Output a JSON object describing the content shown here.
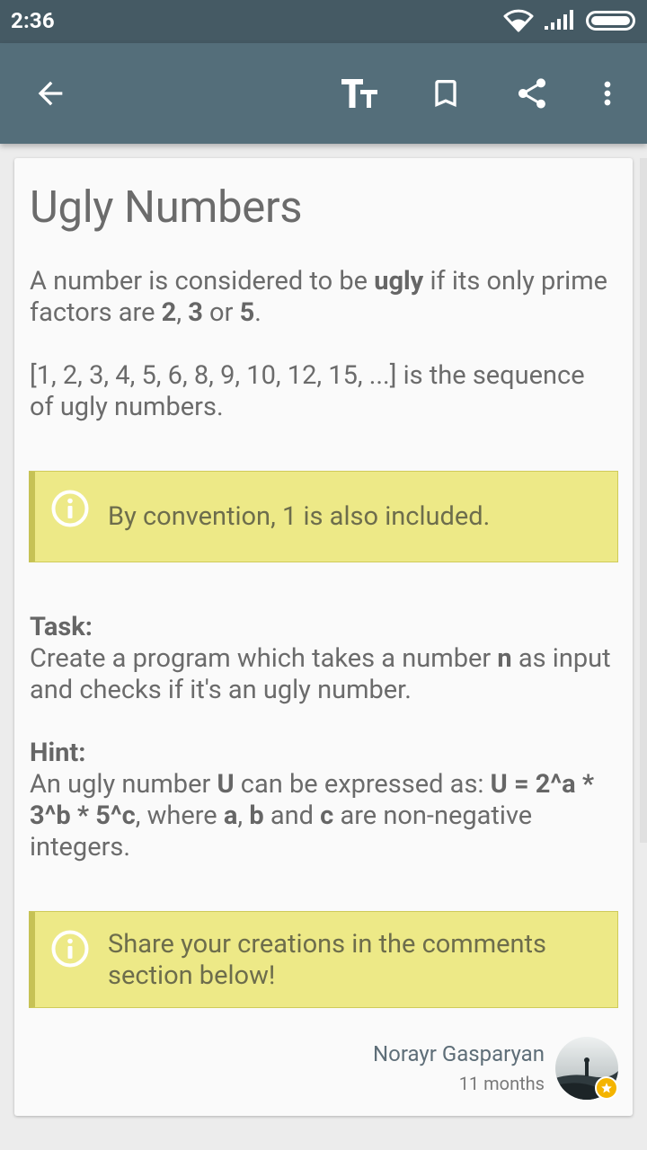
{
  "status_bar": {
    "time": "2:36"
  },
  "toolbar": {
    "icons": [
      "back-arrow-icon",
      "text-size-icon",
      "bookmark-icon",
      "share-icon",
      "more-vert-icon"
    ]
  },
  "article": {
    "title": "Ugly Numbers",
    "p1": {
      "t1": "A number is considered to be ",
      "b1": "ugly",
      "t2": " if its only prime factors are ",
      "b2": "2",
      "t3": ", ",
      "b3": "3",
      "t4": " or ",
      "b4": "5",
      "t5": "."
    },
    "p2": "[1, 2, 3, 4, 5, 6, 8, 9, 10, 12, 15, ...] is the sequence of ugly numbers.",
    "note1": "By convention, 1 is also included.",
    "task": {
      "heading": "Task:",
      "t1": "Create a program which takes a number ",
      "b1": "n",
      "t2": " as input and checks if it's an ugly number."
    },
    "hint": {
      "heading": "Hint:",
      "t1": "An ugly number ",
      "b1": "U",
      "t2": " can be expressed as: ",
      "b2": "U = 2^a * 3^b * 5^c",
      "t3": ", where ",
      "b3": "a",
      "t4": ", ",
      "b4": "b",
      "t5": " and ",
      "b5": "c",
      "t6": " are non-negative integers."
    },
    "note2": "Share your creations in the comments section below!"
  },
  "author": {
    "name": "Norayr Gasparyan",
    "time": "11 months"
  },
  "colors": {
    "status_bar": "#455a64",
    "toolbar": "#546e7a",
    "note_bg": "#ede987",
    "note_border": "#c6c255",
    "badge": "#f4b400"
  }
}
